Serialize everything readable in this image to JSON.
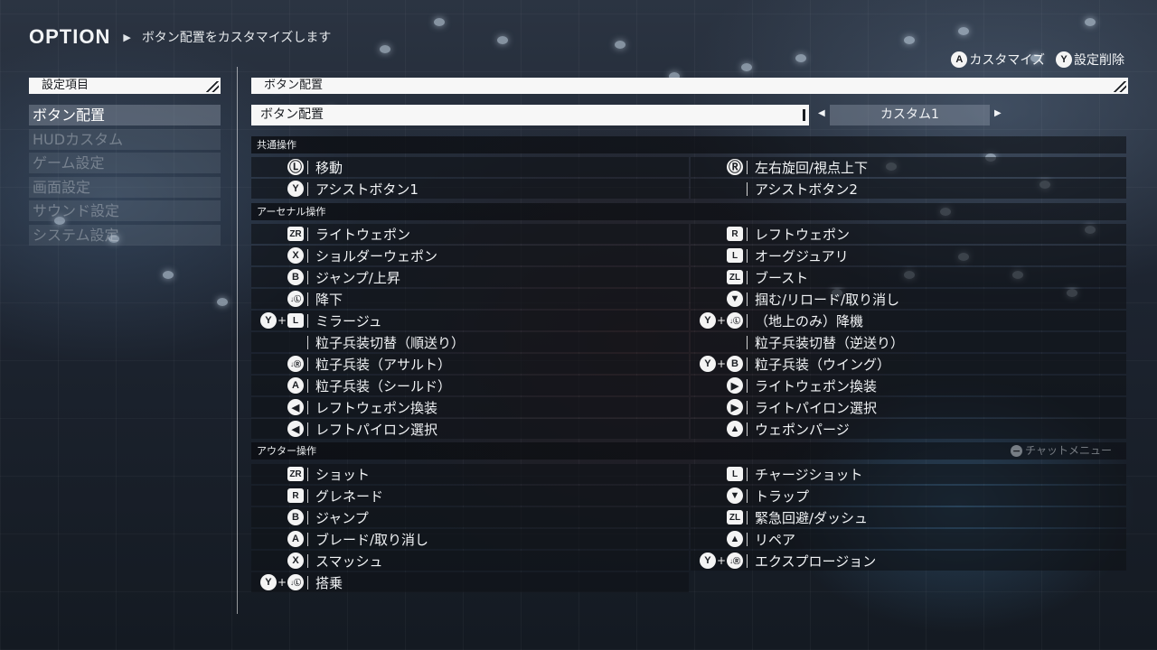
{
  "header": {
    "title": "OPTION",
    "subtitle": "ボタン配置をカスタマイズします"
  },
  "hints": [
    {
      "button": "A",
      "label": "カスタマイズ"
    },
    {
      "button": "Y",
      "label": "設定削除"
    }
  ],
  "left_panel": {
    "heading": "設定項目",
    "items": [
      "ボタン配置",
      "HUDカスタム",
      "ゲーム設定",
      "画面設定",
      "サウンド設定",
      "システム設定"
    ],
    "active_index": 0
  },
  "main_panel": {
    "heading": "ボタン配置",
    "preset_label": "ボタン配置",
    "preset_value": "カスタム1",
    "prev_arrow": "◀",
    "next_arrow": "▶"
  },
  "sections": [
    {
      "title": "共通操作",
      "left": [
        {
          "icon": [
            "Ⓛ"
          ],
          "label": "移動"
        },
        {
          "icon": [
            "Y"
          ],
          "label": "アシストボタン1"
        }
      ],
      "right": [
        {
          "icon": [
            "Ⓡ"
          ],
          "label": "左右旋回/視点上下"
        },
        {
          "icon": [],
          "label": "アシストボタン2"
        }
      ]
    },
    {
      "title": "アーセナル操作",
      "left": [
        {
          "icon": [
            "ZR"
          ],
          "label": "ライトウェポン"
        },
        {
          "icon": [
            "X"
          ],
          "label": "ショルダーウェポン"
        },
        {
          "icon": [
            "B"
          ],
          "label": "ジャンプ/上昇"
        },
        {
          "icon": [
            "↓Ⓛ"
          ],
          "label": "降下"
        },
        {
          "icon": [
            "Y",
            "L"
          ],
          "label": "ミラージュ"
        },
        {
          "icon": [],
          "label": "粒子兵装切替（順送り）"
        },
        {
          "icon": [
            "↓Ⓡ"
          ],
          "label": "粒子兵装（アサルト）"
        },
        {
          "icon": [
            "A"
          ],
          "label": "粒子兵装（シールド）"
        },
        {
          "icon": [
            "◀"
          ],
          "label": "レフトウェポン換装"
        },
        {
          "icon": [
            "◀"
          ],
          "label": "レフトパイロン選択"
        }
      ],
      "right": [
        {
          "icon": [
            "R"
          ],
          "label": "レフトウェポン"
        },
        {
          "icon": [
            "L"
          ],
          "label": "オーグジュアリ"
        },
        {
          "icon": [
            "ZL"
          ],
          "label": "ブースト"
        },
        {
          "icon": [
            "▼"
          ],
          "label": "掴む/リロード/取り消し"
        },
        {
          "icon": [
            "Y",
            "↓Ⓛ"
          ],
          "label": "（地上のみ）降機"
        },
        {
          "icon": [],
          "label": "粒子兵装切替（逆送り）"
        },
        {
          "icon": [
            "Y",
            "B"
          ],
          "label": "粒子兵装（ウイング）"
        },
        {
          "icon": [
            "▶"
          ],
          "label": "ライトウェポン換装"
        },
        {
          "icon": [
            "▶"
          ],
          "label": "ライトパイロン選択"
        },
        {
          "icon": [
            "▲"
          ],
          "label": "ウェポンパージ"
        }
      ]
    },
    {
      "title": "アウター操作",
      "aside": {
        "icon": "−",
        "label": "チャットメニュー"
      },
      "left": [
        {
          "icon": [
            "ZR"
          ],
          "label": "ショット"
        },
        {
          "icon": [
            "R"
          ],
          "label": "グレネード"
        },
        {
          "icon": [
            "B"
          ],
          "label": "ジャンプ"
        },
        {
          "icon": [
            "A"
          ],
          "label": "ブレード/取り消し"
        },
        {
          "icon": [
            "X"
          ],
          "label": "スマッシュ"
        },
        {
          "icon": [
            "Y",
            "↓Ⓛ"
          ],
          "label": "搭乗"
        }
      ],
      "right": [
        {
          "icon": [
            "L"
          ],
          "label": "チャージショット"
        },
        {
          "icon": [
            "▼"
          ],
          "label": "トラップ"
        },
        {
          "icon": [
            "ZL"
          ],
          "label": "緊急回避/ダッシュ"
        },
        {
          "icon": [
            "▲"
          ],
          "label": "リペア"
        },
        {
          "icon": [
            "Y",
            "↓Ⓡ"
          ],
          "label": "エクスプロージョン"
        }
      ]
    }
  ],
  "colors": {
    "panel_white": "#f7f7f7",
    "text": "#f2f4f6",
    "row_bg": "#0e1116",
    "menu_active": "#969faf"
  }
}
